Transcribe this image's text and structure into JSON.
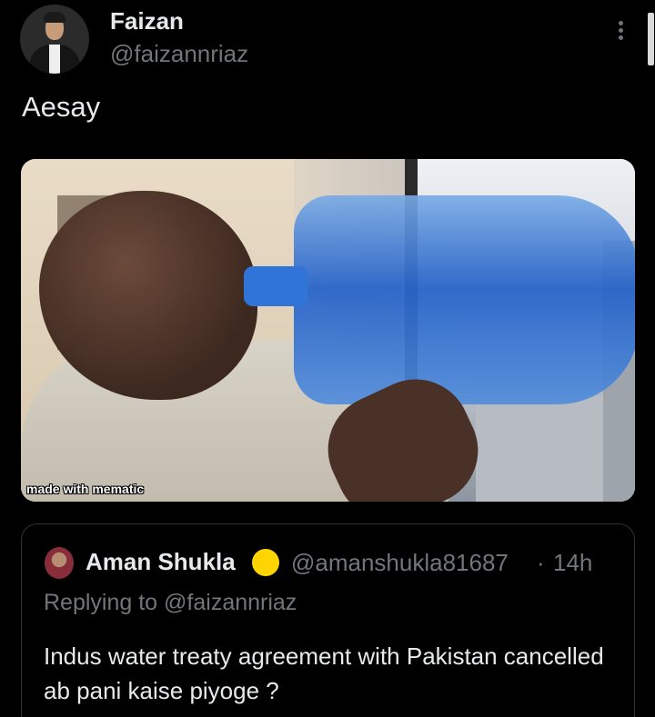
{
  "author": {
    "display_name": "Faizan",
    "handle": "@faizannriaz"
  },
  "tweet": {
    "text": "Aesay",
    "media": {
      "watermark": "made with mematic"
    }
  },
  "quoted_tweet": {
    "display_name": "Aman Shukla",
    "handle": "@amanshukla81687",
    "separator": "·",
    "time": "14h",
    "replying_prefix": "Replying to",
    "replying_to": "@faizannriaz",
    "text": "Indus water treaty agreement with Pakistan cancelled ab pani kaise piyoge ?"
  },
  "colors": {
    "background": "#000000",
    "text_primary": "#e7e9ea",
    "text_secondary": "#71767b",
    "border": "#2f3336",
    "verified_badge": "#ffd400"
  },
  "icons": {
    "more": "more-vertical-icon",
    "verified": "gold-verified-badge-icon"
  }
}
